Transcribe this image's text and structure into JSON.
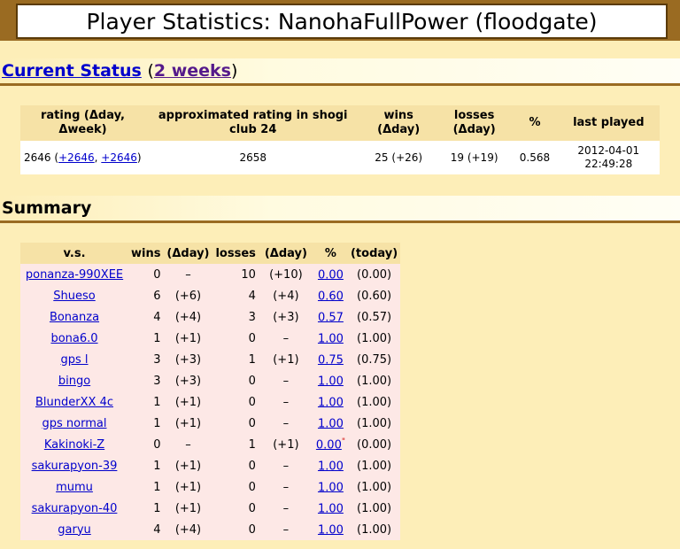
{
  "title": "Player Statistics: NanohaFullPower (floodgate)",
  "current_status": {
    "heading_link": "Current Status",
    "open_paren": "(",
    "weeks_link": "2 weeks",
    "close_paren": ")",
    "headers": [
      "rating (Δday, Δweek)",
      "approximated rating in shogi club 24",
      "wins (Δday)",
      "losses (Δday)",
      "%",
      "last played"
    ],
    "rating": "2646",
    "rating_open": "(",
    "delta_day_link": "+2646",
    "delta_sep": ", ",
    "delta_week_link": "+2646",
    "rating_close": ")",
    "approx_rating": "2658",
    "wins": "25 (+26)",
    "losses": "19 (+19)",
    "pct": "0.568",
    "last_played_date": "2012-04-01",
    "last_played_time": "22:49:28"
  },
  "summary": {
    "heading": "Summary",
    "headers": [
      "v.s.",
      "wins",
      "(Δday)",
      "losses",
      "(Δday)",
      "%",
      "(today)"
    ],
    "rows": [
      {
        "vs": "ponanza-990XEE",
        "wins": "0",
        "wins_d": "–",
        "losses": "10",
        "losses_d": "(+10)",
        "pct": "0.00",
        "today": "(0.00)",
        "flag": ""
      },
      {
        "vs": "Shueso",
        "wins": "6",
        "wins_d": "(+6)",
        "losses": "4",
        "losses_d": "(+4)",
        "pct": "0.60",
        "today": "(0.60)",
        "flag": ""
      },
      {
        "vs": "Bonanza",
        "wins": "4",
        "wins_d": "(+4)",
        "losses": "3",
        "losses_d": "(+3)",
        "pct": "0.57",
        "today": "(0.57)",
        "flag": ""
      },
      {
        "vs": "bona6.0",
        "wins": "1",
        "wins_d": "(+1)",
        "losses": "0",
        "losses_d": "–",
        "pct": "1.00",
        "today": "(1.00)",
        "flag": ""
      },
      {
        "vs": "gps l",
        "wins": "3",
        "wins_d": "(+3)",
        "losses": "1",
        "losses_d": "(+1)",
        "pct": "0.75",
        "today": "(0.75)",
        "flag": ""
      },
      {
        "vs": "bingo",
        "wins": "3",
        "wins_d": "(+3)",
        "losses": "0",
        "losses_d": "–",
        "pct": "1.00",
        "today": "(1.00)",
        "flag": ""
      },
      {
        "vs": "BlunderXX 4c",
        "wins": "1",
        "wins_d": "(+1)",
        "losses": "0",
        "losses_d": "–",
        "pct": "1.00",
        "today": "(1.00)",
        "flag": ""
      },
      {
        "vs": "gps normal",
        "wins": "1",
        "wins_d": "(+1)",
        "losses": "0",
        "losses_d": "–",
        "pct": "1.00",
        "today": "(1.00)",
        "flag": ""
      },
      {
        "vs": "Kakinoki-Z",
        "wins": "0",
        "wins_d": "–",
        "losses": "1",
        "losses_d": "(+1)",
        "pct": "0.00",
        "today": "(0.00)",
        "flag": "\""
      },
      {
        "vs": "sakurapyon-39",
        "wins": "1",
        "wins_d": "(+1)",
        "losses": "0",
        "losses_d": "–",
        "pct": "1.00",
        "today": "(1.00)",
        "flag": ""
      },
      {
        "vs": "mumu",
        "wins": "1",
        "wins_d": "(+1)",
        "losses": "0",
        "losses_d": "–",
        "pct": "1.00",
        "today": "(1.00)",
        "flag": ""
      },
      {
        "vs": "sakurapyon-40",
        "wins": "1",
        "wins_d": "(+1)",
        "losses": "0",
        "losses_d": "–",
        "pct": "1.00",
        "today": "(1.00)",
        "flag": ""
      },
      {
        "vs": "garyu",
        "wins": "4",
        "wins_d": "(+4)",
        "losses": "0",
        "losses_d": "–",
        "pct": "1.00",
        "today": "(1.00)",
        "flag": ""
      }
    ]
  }
}
